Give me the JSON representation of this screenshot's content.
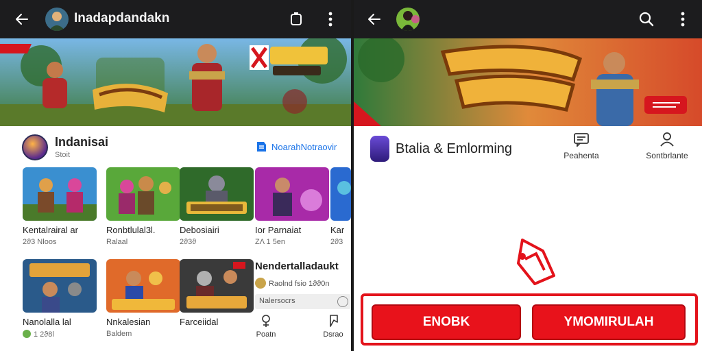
{
  "left": {
    "topbar": {
      "title": "Inadapdandakn"
    },
    "app": {
      "name": "Indanisai",
      "sub": "Stoit",
      "newsletter": "NoarahNotraovir"
    },
    "cards_row1": [
      {
        "name": "Kentalrairal ar",
        "meta": "2ϑ3 Nloos"
      },
      {
        "name": "Ronbtlulal3l.",
        "meta": "Ralaal"
      },
      {
        "name": "Debosiairi",
        "meta": "2ϑ3ϑ"
      },
      {
        "name": "Ior Parnaiat",
        "meta": "ZΛ 1 5en"
      },
      {
        "name": "Kar",
        "meta": "2ϑ3"
      }
    ],
    "cards_row2": [
      {
        "name": "Nanolalla lal",
        "meta": "1 2ϑ8l"
      },
      {
        "name": "Nnkalesian",
        "meta": "Baldem"
      },
      {
        "name": "Farceiidal",
        "meta": ""
      }
    ],
    "news": {
      "title": "Nendertalladaukt",
      "line": "Raolnd fsio 1ϑϑ0n",
      "input": "Nalersocrs"
    },
    "bottom_actions": [
      {
        "label": "Poatn"
      },
      {
        "label": "Dsrao"
      }
    ]
  },
  "right": {
    "title_row": {
      "name": "Btalia & Emlorming"
    },
    "tabs": [
      {
        "label": "Peahenta"
      },
      {
        "label": "Sontbrlante"
      }
    ],
    "cta": {
      "primary": "ENOBK",
      "secondary": "YMOMIRULAH"
    }
  },
  "colors": {
    "accent_red": "#e8121b",
    "topbar": "#1c1c1e",
    "link_blue": "#1a73e8"
  },
  "icons": [
    "back-arrow-icon",
    "share-icon",
    "more-vert-icon",
    "search-icon",
    "newspaper-icon",
    "person-icon",
    "pin-icon",
    "bookmark-icon"
  ]
}
